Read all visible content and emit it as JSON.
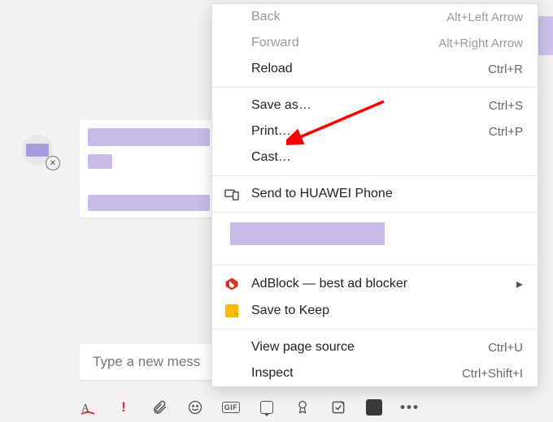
{
  "compose": {
    "placeholder": "Type a new mess"
  },
  "menu": {
    "back": {
      "label": "Back",
      "shortcut": "Alt+Left Arrow"
    },
    "forward": {
      "label": "Forward",
      "shortcut": "Alt+Right Arrow"
    },
    "reload": {
      "label": "Reload",
      "shortcut": "Ctrl+R"
    },
    "saveas": {
      "label": "Save as…",
      "shortcut": "Ctrl+S"
    },
    "print": {
      "label": "Print…",
      "shortcut": "Ctrl+P"
    },
    "cast": {
      "label": "Cast…"
    },
    "sendto": {
      "label": "Send to HUAWEI Phone"
    },
    "adblock": {
      "label": "AdBlock — best ad blocker"
    },
    "keep": {
      "label": "Save to Keep"
    },
    "viewsource": {
      "label": "View page source",
      "shortcut": "Ctrl+U"
    },
    "inspect": {
      "label": "Inspect",
      "shortcut": "Ctrl+Shift+I"
    }
  }
}
